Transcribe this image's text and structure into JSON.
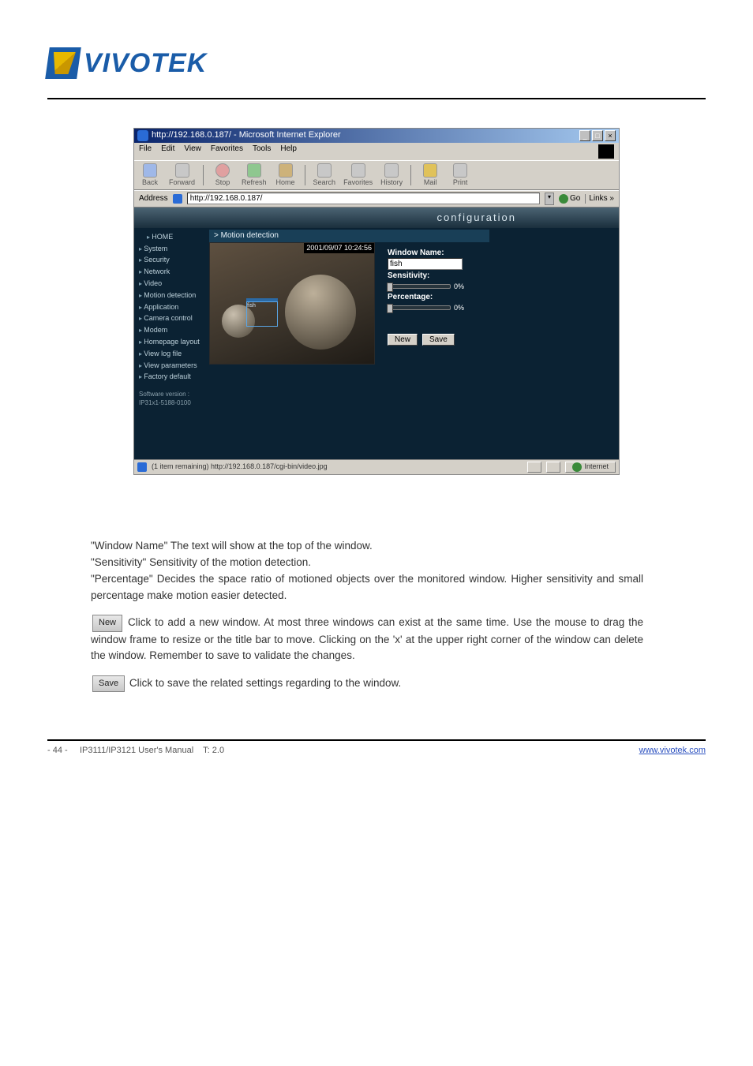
{
  "brand": "VIVOTEK",
  "browser": {
    "title": "http://192.168.0.187/ - Microsoft Internet Explorer",
    "menu": {
      "file": "File",
      "edit": "Edit",
      "view": "View",
      "favorites": "Favorites",
      "tools": "Tools",
      "help": "Help"
    },
    "toolbar": {
      "back": "Back",
      "forward": "Forward",
      "stop": "Stop",
      "refresh": "Refresh",
      "home": "Home",
      "search": "Search",
      "favorites": "Favorites",
      "history": "History",
      "mail": "Mail",
      "print": "Print"
    },
    "address_label": "Address",
    "address_value": "http://192.168.0.187/",
    "go_label": "Go",
    "links_label": "Links »"
  },
  "config_header": "configuration",
  "sidebar": {
    "home": "HOME",
    "items": [
      "System",
      "Security",
      "Network",
      "Video",
      "Motion detection",
      "Application",
      "Camera control",
      "Modem",
      "Homepage layout",
      "View log file",
      "View parameters",
      "Factory default"
    ],
    "sw_label": "Software version :",
    "sw_version": "IP31x1-5188-0100"
  },
  "panel": {
    "title": "> Motion detection",
    "timestamp": "2001/09/07 10:24:56",
    "window_region_label": "fish",
    "window_name_label": "Window Name:",
    "window_name_value": "fish",
    "sensitivity_label": "Sensitivity:",
    "sensitivity_value": "0%",
    "percentage_label": "Percentage:",
    "percentage_value": "0%",
    "new_btn": "New",
    "save_btn": "Save"
  },
  "statusbar": {
    "text": "(1 item remaining) http://192.168.0.187/cgi-bin/video.jpg",
    "zone": "Internet"
  },
  "body": {
    "p1a": "\"Window Name\"  The text will show at the top of the window.",
    "p1b": "\"Sensitivity\"  Sensitivity of the motion detection.",
    "p1c": "\"Percentage\"  Decides the space ratio of motioned objects over the monitored window. Higher sensitivity and small percentage make motion easier detected.",
    "p2a": "  Click to add a new window. At most three windows can exist at the same time. Use the mouse to drag the window frame to resize or the title bar to move. Clicking on the 'x' at the upper right corner of the window can delete the window. Remember to save to validate the changes.",
    "p3a": "  Click to save the related settings regarding to the window.",
    "btn_new": "New",
    "btn_save": "Save"
  },
  "footer": {
    "left_model": "IP3111/IP3121 User's Manual",
    "left_ver": "T: 2.0",
    "right_text": "www.vivotek.com",
    "right_href": "http://www.vivotek.com",
    "page_top": "- 44 -"
  }
}
